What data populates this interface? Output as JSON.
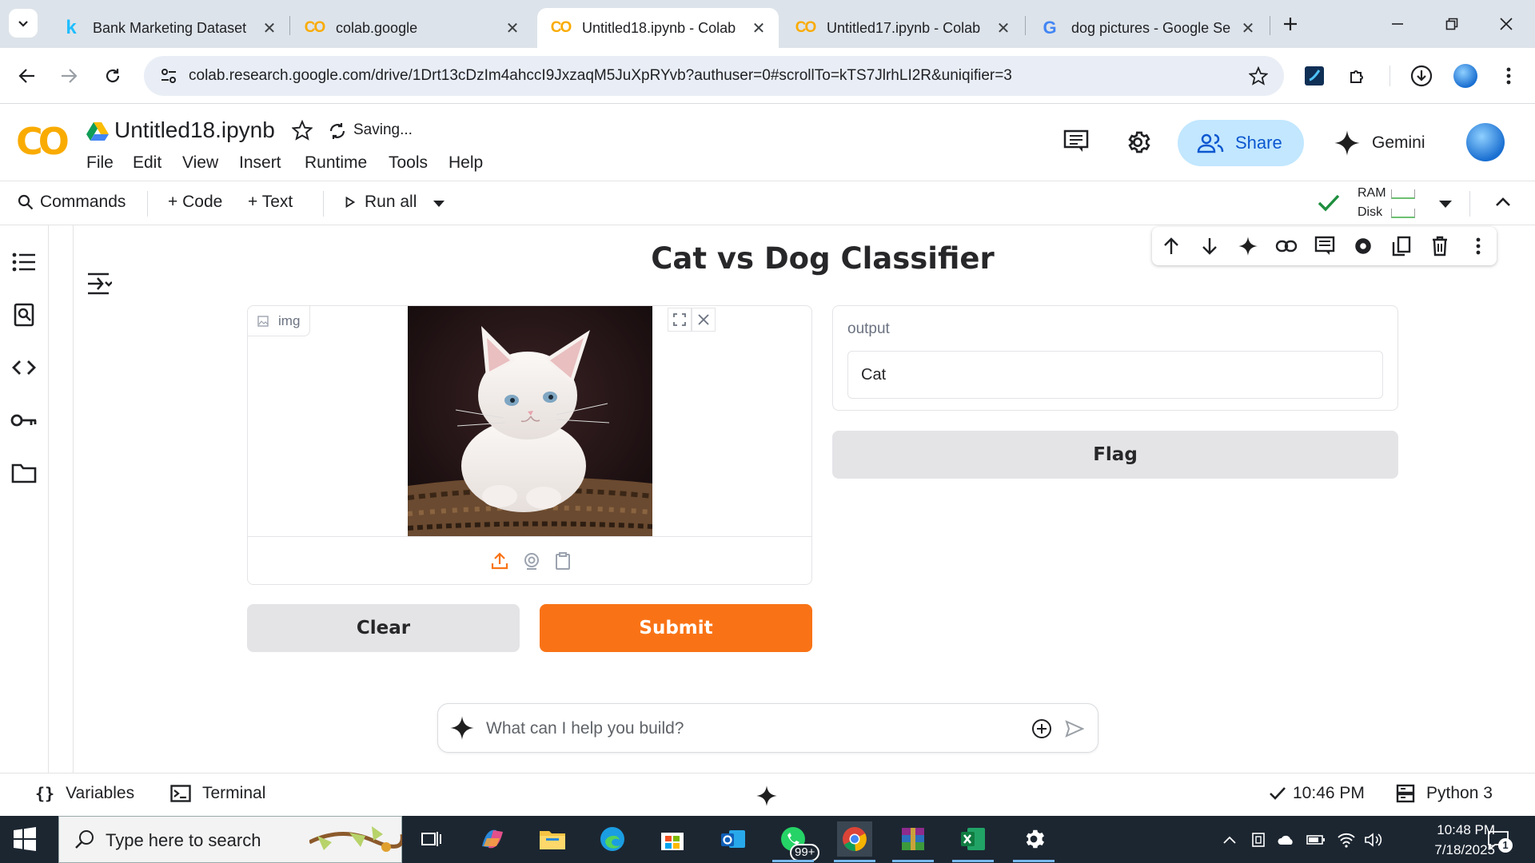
{
  "browser": {
    "tabs": [
      {
        "title": "Bank Marketing Dataset",
        "icon": "kaggle-icon",
        "active": false
      },
      {
        "title": "colab.google",
        "icon": "colab-icon",
        "active": false
      },
      {
        "title": "Untitled18.ipynb - Colab",
        "icon": "colab-icon",
        "active": true
      },
      {
        "title": "Untitled17.ipynb - Colab",
        "icon": "colab-icon",
        "active": false
      },
      {
        "title": "dog pictures - Google Se",
        "icon": "google-icon",
        "active": false
      }
    ],
    "url": "colab.research.google.com/drive/1Drt13cDzIm4ahccI9JxzaqM5JuXpRYvb?authuser=0#scrollTo=kTS7JlrhLI2R&uniqifier=3"
  },
  "colab": {
    "logo_text": "CO",
    "notebook_title": "Untitled18.ipynb",
    "saving_status": "Saving...",
    "menu": [
      "File",
      "Edit",
      "View",
      "Insert",
      "Runtime",
      "Tools",
      "Help"
    ],
    "share_label": "Share",
    "gemini_label": "Gemini",
    "toolbar": {
      "commands": "Commands",
      "code": "+ Code",
      "text": "+ Text",
      "run_all": "Run all",
      "ram": "RAM",
      "disk": "Disk"
    }
  },
  "app": {
    "title": "Cat vs Dog Classifier",
    "image_label": "img",
    "output_label": "output",
    "output_value": "Cat",
    "flag_label": "Flag",
    "clear_label": "Clear",
    "submit_label": "Submit",
    "accent_color": "#f97316"
  },
  "ai_prompt": {
    "placeholder": "What can I help you build?"
  },
  "statusbar": {
    "variables": "Variables",
    "terminal": "Terminal",
    "exec_time": "10:46 PM",
    "runtime": "Python 3"
  },
  "taskbar": {
    "search_placeholder": "Type here to search",
    "whatsapp_badge": "99+",
    "time": "10:48 PM",
    "date": "7/18/2025",
    "notifications": "1"
  }
}
